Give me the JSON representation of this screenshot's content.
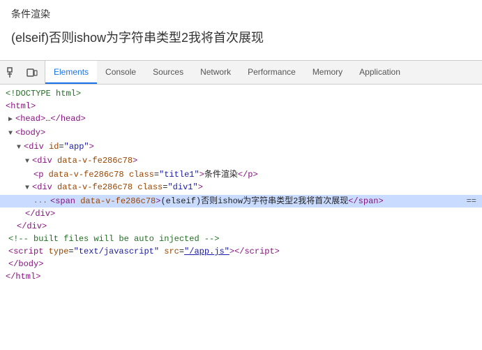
{
  "page": {
    "title": "条件渲染",
    "subtitle": "(elseif)否则ishow为字符串类型2我将首次展现"
  },
  "devtools": {
    "tabs": [
      {
        "id": "elements",
        "label": "Elements",
        "active": true
      },
      {
        "id": "console",
        "label": "Console",
        "active": false
      },
      {
        "id": "sources",
        "label": "Sources",
        "active": false
      },
      {
        "id": "network",
        "label": "Network",
        "active": false
      },
      {
        "id": "performance",
        "label": "Performance",
        "active": false
      },
      {
        "id": "memory",
        "label": "Memory",
        "active": false
      },
      {
        "id": "application",
        "label": "Application",
        "active": false
      }
    ],
    "code": {
      "lines": [
        {
          "indent": 0,
          "html": "&lt;!DOCTYPE html&gt;",
          "color": "comment"
        },
        {
          "indent": 0,
          "html": "<span class='c-tag'>&lt;html&gt;</span>"
        },
        {
          "indent": 1,
          "html": "<span class='expand-arrow'>▶</span><span class='c-tag'>&lt;head&gt;</span><span class='c-text'>…</span><span class='c-tag'>&lt;/head&gt;</span>"
        },
        {
          "indent": 1,
          "html": "<span class='expand-arrow'>▼</span><span class='c-tag'>&lt;body&gt;</span>"
        },
        {
          "indent": 2,
          "html": "<span class='expand-arrow'>▼</span><span class='c-tag'>&lt;div </span><span class='c-attr'>id</span><span class='c-eq'>=</span><span class='c-val'>\"app\"</span><span class='c-tag'>&gt;</span>"
        },
        {
          "indent": 3,
          "html": "<span class='expand-arrow'>▼</span><span class='c-tag'>&lt;div </span><span class='c-attr'>data-v-fe286c78</span><span class='c-tag'>&gt;</span>"
        },
        {
          "indent": 4,
          "html": "<span class='c-tag'>&lt;p </span><span class='c-attr'>data-v-fe286c78</span> <span class='c-attr'>class</span><span class='c-eq'>=</span><span class='c-val'>\"title1\"</span><span class='c-tag'>&gt;</span><span class='c-text'>条件渲染</span><span class='c-tag'>&lt;/p&gt;</span>"
        },
        {
          "indent": 3,
          "html": "<span class='expand-arrow'>▼</span><span class='c-tag'>&lt;div </span><span class='c-attr'>data-v-fe286c78</span> <span class='c-attr'>class</span><span class='c-eq'>=</span><span class='c-val'>\"div1\"</span><span class='c-tag'>&gt;</span>"
        },
        {
          "indent": 4,
          "html": "<span class='c-tag'>&lt;span </span><span class='c-attr'>data-v-fe286c78</span><span class='c-tag'>&gt;</span><span class='c-text'>(elseif)否则ishow为字符串类型2我将首次展现</span><span class='c-tag'>&lt;/span&gt;</span>",
          "highlighted": true
        },
        {
          "indent": 3,
          "html": "<span class='c-tag'>&lt;/div&gt;</span>"
        },
        {
          "indent": 2,
          "html": "<span class='c-tag'>&lt;/div&gt;</span>"
        },
        {
          "indent": 1,
          "html": "<span class='c-comment'>&lt;!-- built files will be auto injected --&gt;</span>"
        },
        {
          "indent": 1,
          "html": "<span class='c-tag'>&lt;script </span><span class='c-attr'>type</span><span class='c-eq'>=</span><span class='c-val'>\"text/javascript\"</span> <span class='c-attr'>src</span><span class='c-eq'>=</span><span class='c-val'>\"/app.js\"</span><span class='c-tag'>&gt;&lt;/script&gt;</span>"
        },
        {
          "indent": 1,
          "html": "<span class='c-tag'>&lt;/body&gt;</span>"
        },
        {
          "indent": 0,
          "html": "<span class='c-tag'>&lt;/html&gt;</span>"
        }
      ]
    }
  }
}
